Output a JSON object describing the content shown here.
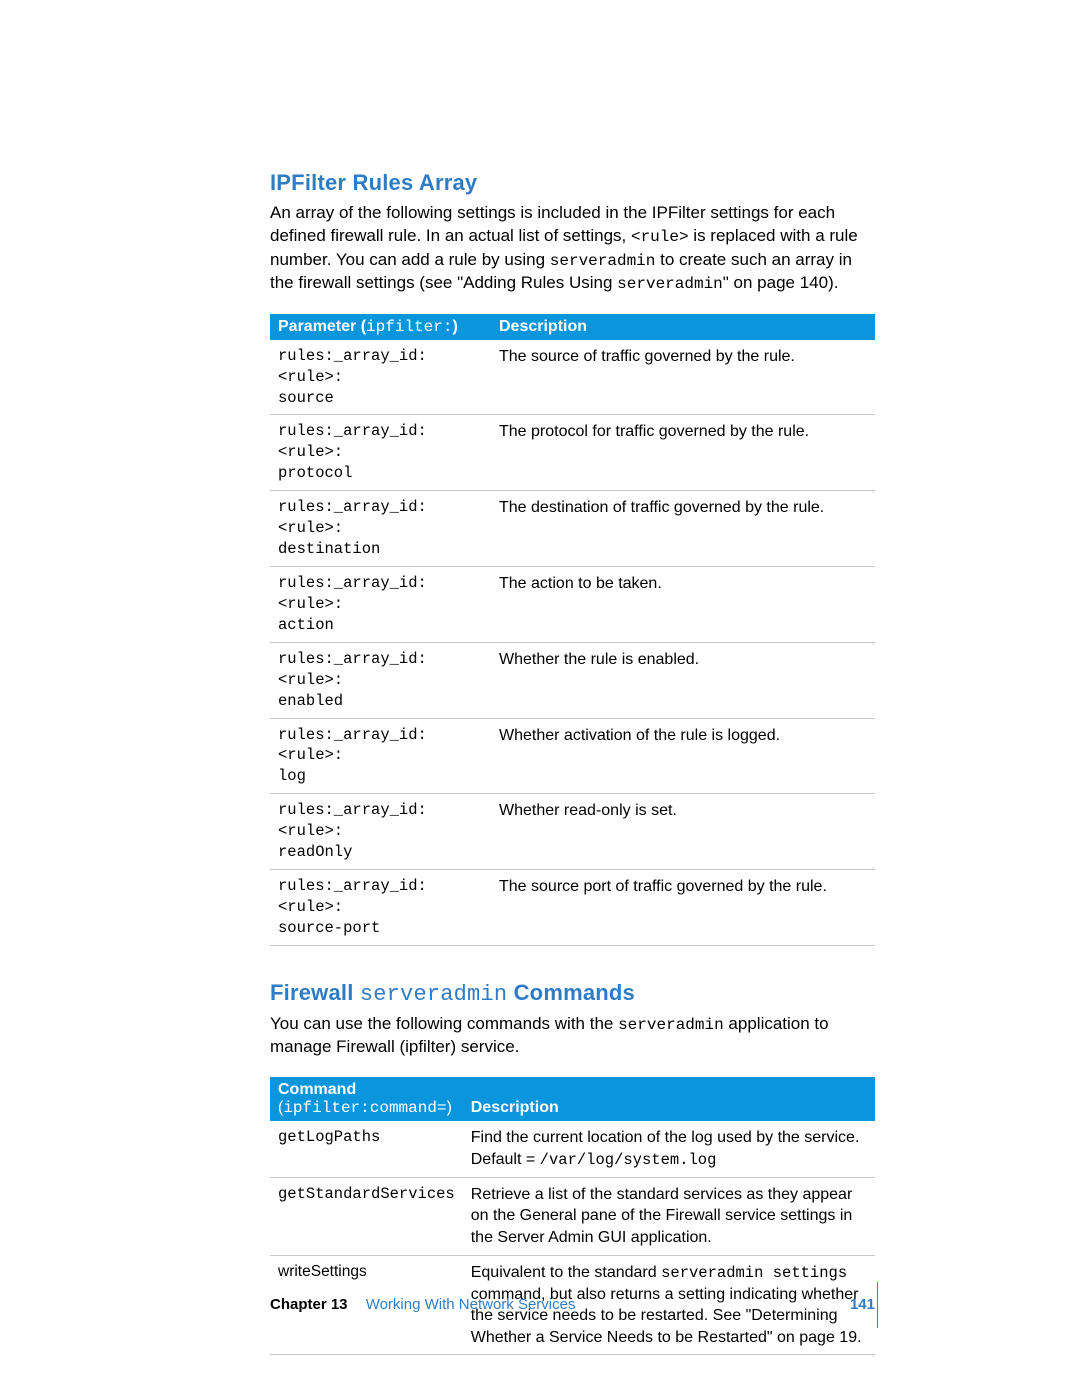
{
  "section1": {
    "heading": "IPFilter Rules Array",
    "para_parts": {
      "p1": "An array of the following settings is included in the IPFilter settings for each defined firewall rule. In an actual list of settings, ",
      "rule": "<rule>",
      "p2": " is replaced with a rule number. You can add a rule by using ",
      "sa": "serveradmin",
      "p3": " to create such an array in the firewall settings (see \"Adding Rules Using ",
      "sa2": "serveradmin",
      "p4": "\" on page 140)."
    }
  },
  "table1": {
    "h1a": "Parameter (",
    "h1b": "ipfilter:",
    "h1c": ")",
    "h2": "Description",
    "rows": [
      {
        "param": "rules:_array_id:<rule>:\nsource",
        "desc": "The source of traffic governed by the rule."
      },
      {
        "param": "rules:_array_id:<rule>:\nprotocol",
        "desc": "The protocol for traffic governed by the rule."
      },
      {
        "param": "rules:_array_id:<rule>:\ndestination",
        "desc": "The destination of traffic governed by the rule."
      },
      {
        "param": "rules:_array_id:<rule>:\naction",
        "desc": "The action to be taken."
      },
      {
        "param": "rules:_array_id:<rule>:\nenabled",
        "desc": "Whether the rule is enabled."
      },
      {
        "param": "rules:_array_id:<rule>:\nlog",
        "desc": "Whether activation of the rule is logged."
      },
      {
        "param": "rules:_array_id:<rule>:\nreadOnly",
        "desc": "Whether read-only is set."
      },
      {
        "param": "rules:_array_id:<rule>:\nsource-port",
        "desc": "The source port of traffic governed by the rule."
      }
    ]
  },
  "section2": {
    "h_a": "Firewall ",
    "h_mono": "serveradmin",
    "h_b": " Commands",
    "para_parts": {
      "p1": "You can use the following commands with the ",
      "sa": "serveradmin",
      "p2": " application to manage Firewall (ipfilter) service."
    }
  },
  "table2": {
    "h1_line1": "Command",
    "h1_line2a": "(",
    "h1_line2b": "ipfilter:command=",
    "h1_line2c": ")",
    "h2": "Description",
    "rows": [
      {
        "cmd": "getLogPaths",
        "cmd_mono": true,
        "desc_pre": "Find the current location of the log used by the service.",
        "desc_line2_a": "Default = ",
        "desc_line2_mono": "/var/log/system.log"
      },
      {
        "cmd": "getStandardServices",
        "cmd_mono": true,
        "desc_pre": "Retrieve a list of the standard services as they appear on the General pane of the Firewall service settings in the Server Admin GUI application."
      },
      {
        "cmd": "writeSettings",
        "cmd_mono": false,
        "desc_parts": {
          "a": "Equivalent to the standard ",
          "m": "serveradmin settings",
          "b": " command, but also returns a setting indicating whether the service needs to be restarted. See \"Determining Whether a Service Needs to be Restarted\" on page 19."
        }
      }
    ]
  },
  "footer": {
    "chapter": "Chapter 13",
    "title": "Working With Network Services",
    "page": "141"
  }
}
